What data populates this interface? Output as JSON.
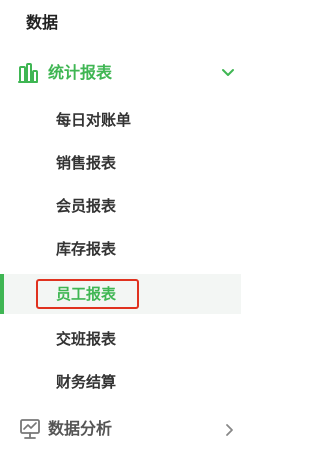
{
  "sidebar": {
    "section_title": "数据",
    "stats_menu": {
      "label": "统计报表",
      "icon": "bar-chart-icon",
      "expanded": true,
      "items": [
        {
          "label": "每日对账单"
        },
        {
          "label": "销售报表"
        },
        {
          "label": "会员报表"
        },
        {
          "label": "库存报表"
        },
        {
          "label": "员工报表",
          "active": true
        },
        {
          "label": "交班报表"
        },
        {
          "label": "财务结算"
        }
      ]
    },
    "analysis_menu": {
      "label": "数据分析",
      "icon": "monitor-chart-icon",
      "expanded": false
    }
  },
  "colors": {
    "accent": "#3fb653",
    "highlight_border": "#e0321f",
    "text": "#333333",
    "active_bg": "#f3f6f4"
  }
}
